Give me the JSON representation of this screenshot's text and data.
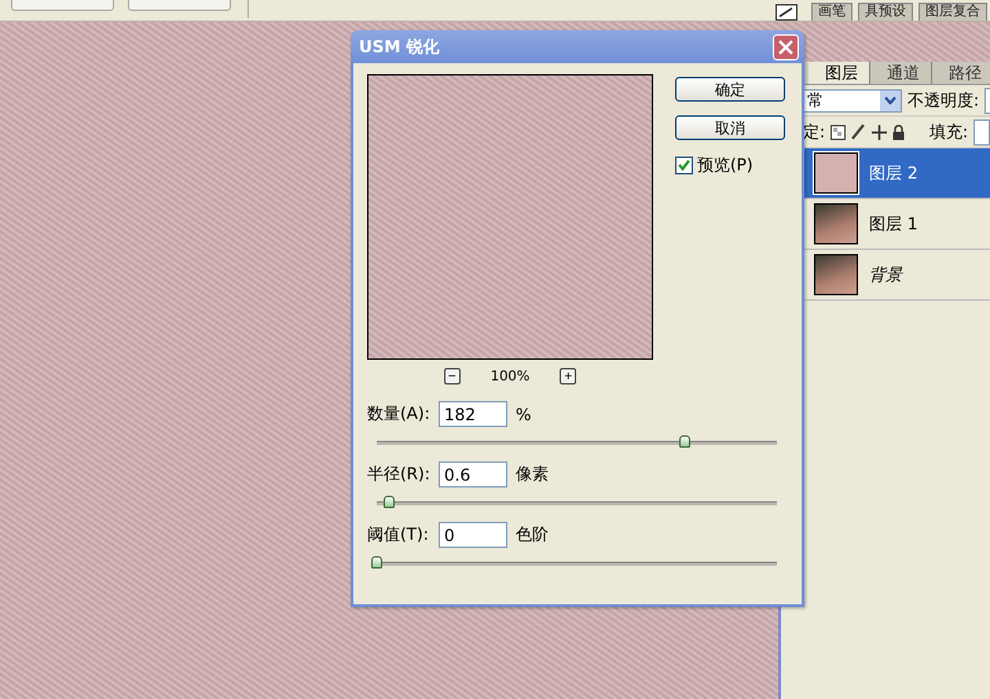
{
  "toolbar": {
    "buttons": [
      {
        "kind": "blank"
      },
      {
        "kind": "blank"
      }
    ],
    "palette_tabs": [
      "画笔",
      "具预设",
      "图层复合"
    ]
  },
  "dialog": {
    "title": "USM 锐化",
    "preview": {
      "zoom": "100%",
      "zoom_out": "−",
      "zoom_in": "+"
    },
    "buttons": [
      "确定",
      "取消"
    ],
    "preview_option": {
      "label": "预览(P)",
      "checked": true
    },
    "params": [
      {
        "label": "数量(A):",
        "value": "182",
        "unit": "%",
        "level": 0.77
      },
      {
        "label": "半径(R):",
        "value": "0.6",
        "unit": "像素",
        "level": 0.03
      },
      {
        "label": "阈值(T):",
        "value": "0",
        "unit": "色阶",
        "level": 0.0
      }
    ]
  },
  "layers_panel": {
    "tabs": [
      {
        "label": "图层",
        "selected": true
      },
      {
        "label": "通道",
        "selected": false
      },
      {
        "label": "路径",
        "selected": false
      }
    ],
    "blend_mode": "常",
    "opacity_label": "不透明度:",
    "lock_label": "定:",
    "fill_label": "填充:",
    "layers": [
      {
        "name": "图层 2",
        "selected": true,
        "kind": "fill",
        "italic": false
      },
      {
        "name": "图层 1",
        "selected": false,
        "kind": "photo",
        "italic": false
      },
      {
        "name": "背景",
        "selected": false,
        "kind": "photo",
        "italic": true
      }
    ]
  }
}
